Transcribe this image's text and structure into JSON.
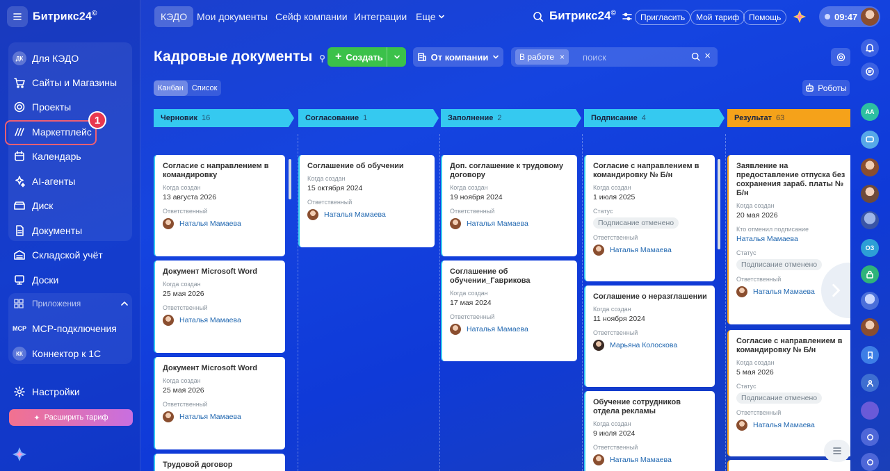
{
  "app": {
    "logo": "Битрикс24",
    "logo_mark": "©",
    "top_logo": "Битрикс24"
  },
  "sidebar": {
    "group1": [
      {
        "label": "Для КЭДО",
        "avatar": "ДК"
      },
      {
        "label": "Сайты и Магазины",
        "icon": "cart-icon"
      },
      {
        "label": "Проекты",
        "icon": "projects-icon"
      },
      {
        "label": "Маркетплейс",
        "icon": "marketplace-icon"
      },
      {
        "label": "Календарь",
        "icon": "calendar-icon"
      },
      {
        "label": "AI-агенты",
        "icon": "ai-icon"
      },
      {
        "label": "Диск",
        "icon": "disk-icon"
      },
      {
        "label": "Документы",
        "icon": "docs-icon"
      }
    ],
    "group2": [
      {
        "label": "Складской учёт",
        "icon": "warehouse-icon"
      },
      {
        "label": "Доски",
        "icon": "boards-icon"
      }
    ],
    "apps_header": "Приложения",
    "apps": [
      {
        "label": "MCP-подключения",
        "avatar": "MCP"
      },
      {
        "label": "Коннектор к 1С",
        "avatar": "КК"
      }
    ],
    "settings": "Настройки",
    "upgrade": "Расширить тариф",
    "marker": "1"
  },
  "topnav": {
    "tabs": [
      "КЭДО",
      "Мои документы",
      "Сейф компании",
      "Интеграции",
      "Еще"
    ],
    "invite": "Пригласить",
    "tariff": "Мой тариф",
    "help": "Помощь",
    "time": "09:47"
  },
  "header": {
    "title": "Кадровые документы",
    "create": "Создать",
    "company": "От компании",
    "filter_chip": "В работе",
    "search_placeholder": "поиск",
    "view_kanban": "Канбан",
    "view_list": "Список",
    "robots": "Роботы"
  },
  "colors": {
    "accent": "#3bc14a",
    "badge": "#e9384f",
    "col_blue": "#35c9f0",
    "col_result": "#f5a21a"
  },
  "columns": [
    {
      "title": "Черновик",
      "count": "16",
      "cards": [
        {
          "title": "Согласие с направлением в командировку",
          "created_label": "Когда создан",
          "created": "13 августа 2026",
          "resp_label": "Ответственный",
          "person": "Наталья Мамаева"
        },
        {
          "title": "Документ Microsoft Word",
          "created_label": "Когда создан",
          "created": "25 мая 2026",
          "resp_label": "Ответственный",
          "person": "Наталья Мамаева"
        },
        {
          "title": "Документ Microsoft Word",
          "created_label": "Когда создан",
          "created": "25 мая 2026",
          "resp_label": "Ответственный",
          "person": "Наталья Мамаева"
        },
        {
          "title": "Трудовой договор"
        }
      ]
    },
    {
      "title": "Согласование",
      "count": "1",
      "cards": [
        {
          "title": "Соглашение об обучении",
          "created_label": "Когда создан",
          "created": "15 октября 2024",
          "resp_label": "Ответственный",
          "person": "Наталья Мамаева"
        }
      ]
    },
    {
      "title": "Заполнение",
      "count": "2",
      "cards": [
        {
          "title": "Доп. соглашение к трудовому договору",
          "created_label": "Когда создан",
          "created": "19 ноября 2024",
          "resp_label": "Ответственный",
          "person": "Наталья Мамаева"
        },
        {
          "title": "Соглашение об обучении_Гаврикова",
          "created_label": "Когда создан",
          "created": "17 мая 2024",
          "resp_label": "Ответственный",
          "person": "Наталья Мамаева"
        }
      ]
    },
    {
      "title": "Подписание",
      "count": "4",
      "cards": [
        {
          "title": "Согласие с направлением в командировку № Б/н",
          "created_label": "Когда создан",
          "created": "1 июля 2025",
          "status_label": "Статус",
          "status": "Подписание отменено",
          "resp_label": "Ответственный",
          "person": "Наталья Мамаева"
        },
        {
          "title": "Соглашение о неразглашении",
          "created_label": "Когда создан",
          "created": "11 ноября 2024",
          "resp_label": "Ответственный",
          "person": "Марьяна Колоскова"
        },
        {
          "title": "Обучение сотрудников отдела рекламы",
          "created_label": "Когда создан",
          "created": "9 июля 2024",
          "resp_label": "Ответственный",
          "person": "Наталья Мамаева"
        }
      ]
    },
    {
      "title": "Результат",
      "count": "63",
      "cards": [
        {
          "title": "Заявление на предоставление отпуска без сохранения зараб. платы № Б/н",
          "created_label": "Когда создан",
          "created": "20 мая 2026",
          "cancel_label": "Кто отменил подписание",
          "cancel_person": "Наталья Мамаева",
          "status_label": "Статус",
          "status": "Подписание отменено",
          "resp_label": "Ответственный",
          "person": "Наталья Мамаева"
        },
        {
          "title": "Согласие с направлением в командировку № Б/н",
          "created_label": "Когда создан",
          "created": "5 мая 2026",
          "status_label": "Статус",
          "status": "Подписание отменено",
          "resp_label": "Ответственный",
          "person": "Наталья Мамаева"
        }
      ]
    }
  ],
  "rail": {
    "avatar_text": "АА",
    "group_text": "ОЗ"
  }
}
